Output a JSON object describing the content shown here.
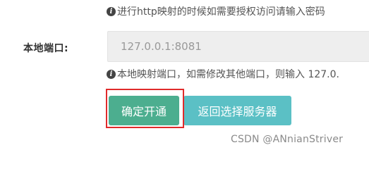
{
  "hints": {
    "auth_hint": "进行http映射的时候如需要授权访问请输入密码",
    "port_hint": "本地映射端口，如需修改其他端口，则输入 127.0."
  },
  "port_field": {
    "label": "本地端口:",
    "value": "127.0.0.1:8081"
  },
  "buttons": {
    "confirm_label": "确定开通",
    "back_label": "返回选择服务器"
  },
  "watermark": "CSDN @ANnianStriver",
  "colors": {
    "confirm_button": "#4cae8f",
    "back_button": "#5bc0c5",
    "highlight_border": "#e02b2b"
  },
  "icons": {
    "info": "info-icon"
  }
}
